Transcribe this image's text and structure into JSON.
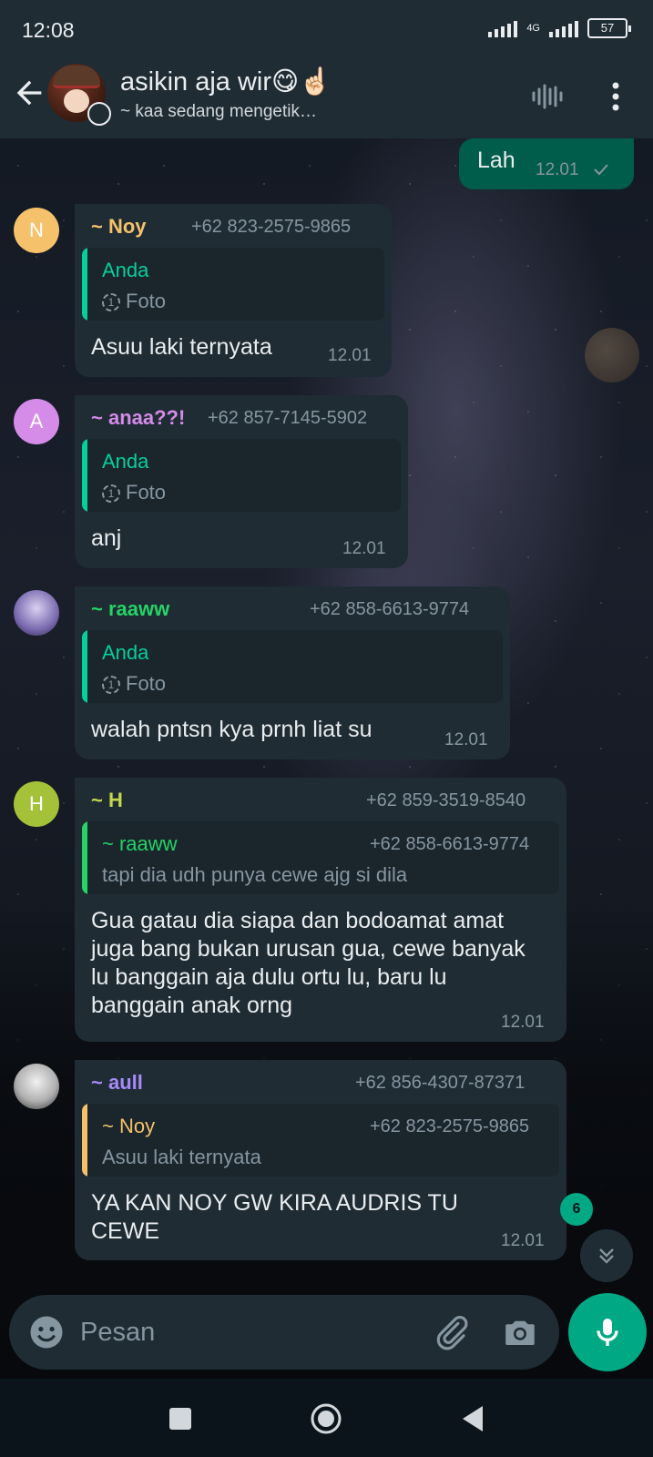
{
  "status_bar": {
    "time": "12:08",
    "network": "4G",
    "battery": "57"
  },
  "header": {
    "title": "asikin aja wir😋☝🏻",
    "subtitle": "~ kaa sedang mengetik…"
  },
  "messages": {
    "m0": {
      "text": "Lah",
      "time": "12.01"
    },
    "m1": {
      "avatar_letter": "N",
      "avatar_color": "#f5c26b",
      "sender": "~ Noy",
      "sender_color": "#f5c26b",
      "phone": "+62 823-2575-9865",
      "quote_name": "Anda",
      "quote_text": "Foto",
      "text": "Asuu laki ternyata",
      "time": "12.01"
    },
    "m2": {
      "avatar_letter": "A",
      "avatar_color": "#d58be8",
      "sender": "~ anaa??!",
      "sender_color": "#d58be8",
      "phone": "+62 857-7145-5902",
      "quote_name": "Anda",
      "quote_text": "Foto",
      "text": "anj",
      "time": "12.01"
    },
    "m3": {
      "sender": "~ raaww",
      "sender_color": "#25d366",
      "phone": "+62 858-6613-9774",
      "quote_name": "Anda",
      "quote_text": "Foto",
      "text": "walah pntsn kya prnh liat su",
      "time": "12.01"
    },
    "m4": {
      "avatar_letter": "H",
      "avatar_color": "#a3c23a",
      "sender": "~ H",
      "sender_color": "#c6d84a",
      "phone": "+62 859-3519-8540",
      "quote_name": "~ raaww",
      "quote_phone": "+62 858-6613-9774",
      "quote_text": "tapi dia udh punya cewe ajg si dila",
      "text": "Gua gatau dia siapa dan bodoamat amat juga bang bukan urusan gua, cewe banyak lu banggain aja dulu ortu lu, baru lu banggain anak orng",
      "time": "12.01"
    },
    "m5": {
      "sender": "~ aull",
      "sender_color": "#a78bfa",
      "phone": "+62 856-4307-87371",
      "quote_name": "~ Noy",
      "quote_phone": "+62 823-2575-9865",
      "quote_text": "Asuu laki ternyata",
      "text": "YA KAN NOY GW KIRA AUDRIS TU CEWE",
      "time": "12.01"
    }
  },
  "unread_count": "6",
  "input": {
    "placeholder": "Pesan",
    "value": ""
  },
  "colors": {
    "accent": "#00a884",
    "out_bubble": "#005c4b",
    "in_bubble": "#1f2c34"
  },
  "icons": [
    "back-arrow-icon",
    "voice-chat-icon",
    "more-icon",
    "emoji-icon",
    "attach-icon",
    "camera-icon",
    "mic-icon",
    "chevron-double-down-icon",
    "square-nav-icon",
    "circle-nav-icon",
    "triangle-nav-icon",
    "view-once-icon",
    "check-icon"
  ]
}
